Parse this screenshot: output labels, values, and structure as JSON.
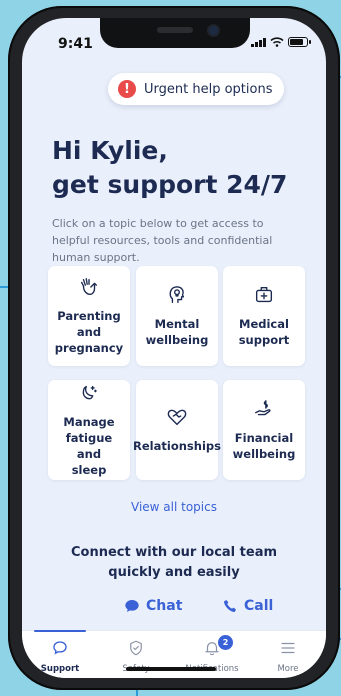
{
  "status": {
    "time": "9:41"
  },
  "urgent": {
    "label": "Urgent help options",
    "icon": "alert-icon"
  },
  "greeting": {
    "line1": "Hi Kylie,",
    "line2": "get support 24/7"
  },
  "intro": "Click on a topic below to get access to helpful resources, tools and confidential human support.",
  "topics": [
    {
      "label_1": "Parenting and",
      "label_2": "pregnancy",
      "icon": "baby-hands-icon"
    },
    {
      "label_1": "Mental",
      "label_2": "wellbeing",
      "icon": "head-lightbulb-icon"
    },
    {
      "label_1": "Medical",
      "label_2": "support",
      "icon": "medical-kit-icon"
    },
    {
      "label_1": "Manage",
      "label_2": "fatigue and",
      "label_3": "sleep",
      "icon": "moon-stars-icon"
    },
    {
      "label_1": "Relationships",
      "icon": "heart-handshake-icon"
    },
    {
      "label_1": "Financial",
      "label_2": "wellbeing",
      "icon": "hand-dollar-icon"
    }
  ],
  "view_all": "View all topics",
  "connect": {
    "line1": "Connect with our local team",
    "line2": "quickly and easily"
  },
  "contact": {
    "chat": "Chat",
    "call": "Call"
  },
  "tabs": [
    {
      "label": "Support",
      "active": true
    },
    {
      "label": "Safety"
    },
    {
      "label": "Notifications",
      "badge": "2"
    },
    {
      "label": "More"
    }
  ],
  "colors": {
    "accent": "#3a61d6",
    "background": "#eaf0fb",
    "text": "#1d2b52",
    "alert": "#e94a4a",
    "callout": "#2d9bd7"
  }
}
